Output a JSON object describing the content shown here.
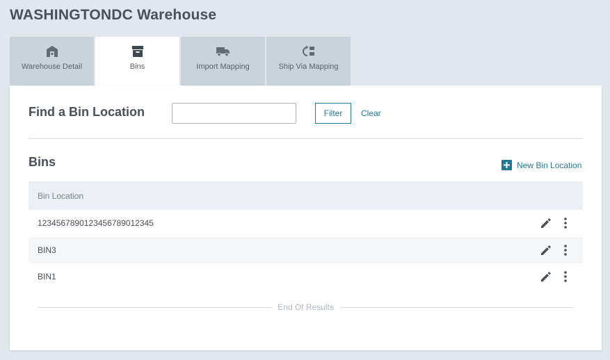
{
  "page": {
    "title": "WASHINGTONDC Warehouse"
  },
  "tabs": [
    {
      "label": "Warehouse Detail",
      "icon": "warehouse-icon",
      "active": false
    },
    {
      "label": "Bins",
      "icon": "archive-box-icon",
      "active": true
    },
    {
      "label": "Import Mapping",
      "icon": "truck-icon",
      "active": false
    },
    {
      "label": "Ship Via Mapping",
      "icon": "swap-shipping-icon",
      "active": false
    }
  ],
  "find": {
    "title": "Find a Bin Location",
    "input_value": "",
    "input_placeholder": "",
    "filter_label": "Filter",
    "clear_label": "Clear"
  },
  "bins": {
    "title": "Bins",
    "new_label": "New Bin Location",
    "column_header": "Bin Location",
    "rows": [
      {
        "location": "1234567890123456789012345"
      },
      {
        "location": "BIN3"
      },
      {
        "location": "BIN1"
      }
    ],
    "end_text": "End Of Results"
  },
  "colors": {
    "accent": "#1f7a98",
    "background": "#e2e7ee",
    "tab_inactive": "#c9d3db",
    "header_row": "#eceff3"
  }
}
